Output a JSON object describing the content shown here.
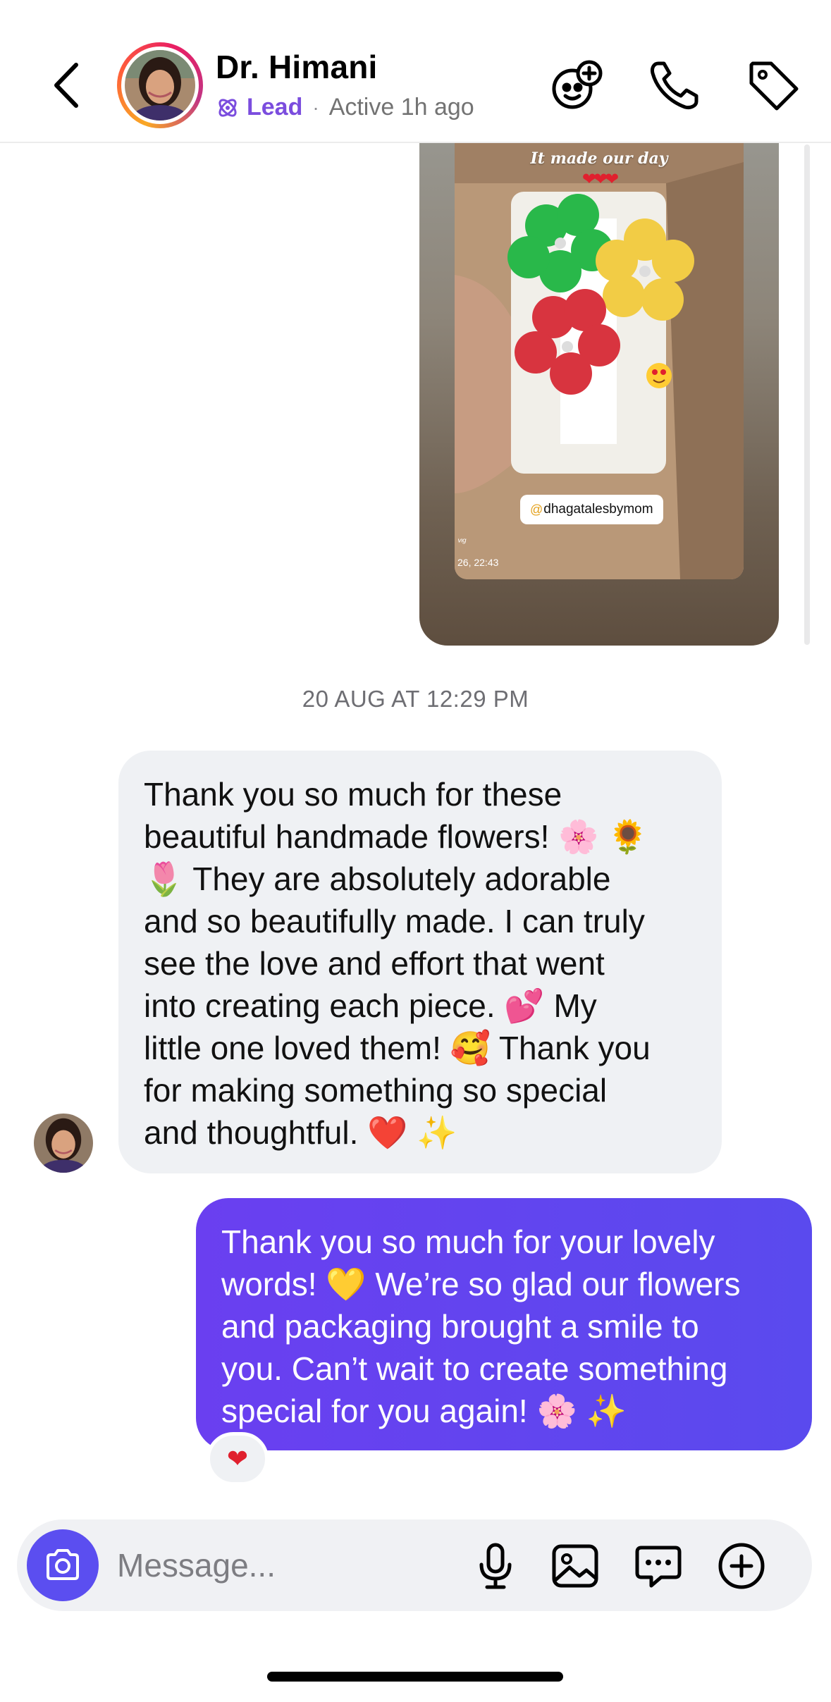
{
  "header": {
    "contact_name": "Dr. Himani",
    "label": "Lead",
    "separator": "·",
    "status": "Active 1h ago",
    "icons": [
      "back-chevron-icon",
      "add-group-icon",
      "phone-icon",
      "tag-icon"
    ]
  },
  "story": {
    "caption": "It made our day",
    "hearts": "❤❤❤",
    "mention": "dhagatalesbymom",
    "mention_prefix": "@",
    "signature": "ᵛᶦᵍ",
    "timestamp_overlay": "26, 22:43"
  },
  "thread": {
    "timestamp": "20 AUG AT 12:29 PM",
    "incoming_message": "Thank you so much for these\nbeautiful handmade flowers! 🌸 🌻\n🌷 They are absolutely adorable\nand so beautifully made. I can truly\nsee the love and effort that went\ninto creating each piece. 💕 My\nlittle one loved them! 🥰 Thank you\nfor making something so special\nand thoughtful. ❤️ ✨",
    "outgoing_message": "Thank you so much for your lovely\nwords! 💛 We’re so glad our flowers\nand packaging brought a smile to\nyou. Can’t wait to create something\nspecial for you again! 🌸 ✨",
    "reaction": "❤"
  },
  "composer": {
    "placeholder": "Message...",
    "icons": [
      "camera-icon",
      "microphone-icon",
      "gallery-icon",
      "sticker-chat-icon",
      "plus-icon"
    ]
  },
  "colors": {
    "accent": "#5b4ef0",
    "lead_purple": "#7b4dde",
    "incoming_bubble": "#eff1f4",
    "outgoing_bubble": "#5f44ec"
  }
}
